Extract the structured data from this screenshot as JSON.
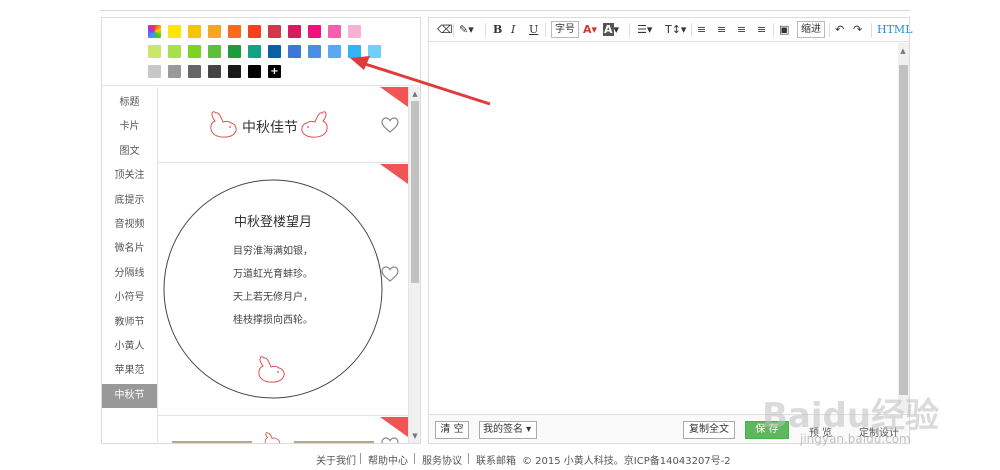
{
  "palette": {
    "row1": [
      "#rainbow",
      "#ffe600",
      "#f7c500",
      "#f5a623",
      "#f96b1b",
      "#f6401b",
      "#d0384b",
      "#d81b60",
      "#f0127c",
      "#f55fb0",
      "#f9b1d2"
    ],
    "row2": [
      "#c9e86a",
      "#a6e04a",
      "#7ed321",
      "#5fbf3d",
      "#1e9b3f",
      "#15a083",
      "#0b5fa5",
      "#3d77d8",
      "#4a90e2",
      "#5aa7f2",
      "#2fb5f5",
      "#6fd0fa"
    ],
    "row3": [
      "#c7c7c7",
      "#999999",
      "#666666",
      "#444444",
      "#1a1a1a",
      "#000000"
    ],
    "plus_label": "+"
  },
  "sidebar": {
    "items": [
      "标题",
      "卡片",
      "图文",
      "顶关注",
      "底提示",
      "音视频",
      "微名片",
      "分隔线",
      "小符号",
      "教师节",
      "小黄人",
      "苹果范",
      "中秋节"
    ],
    "active_index": 12
  },
  "templates": {
    "card1": {
      "title": "中秋佳节"
    },
    "card2": {
      "title": "中秋登楼望月",
      "lines": [
        "目穷淮海满如银，",
        "万道虹光育蚌珍。",
        "天上若无修月户，",
        "桂枝撑损向西轮。"
      ]
    }
  },
  "toolbar": {
    "bold": "B",
    "italic": "I",
    "underline": "U",
    "font_size": "字号",
    "font_color": "A",
    "bg_color": "A",
    "indent": "缩进",
    "html": "HTML"
  },
  "bottom": {
    "clear": "清 空",
    "signature": "我的签名",
    "copy_all": "复制全文",
    "save": "保 存",
    "preview": "预 览",
    "custom": "定制设计"
  },
  "footer": {
    "about": "关于我们",
    "help": "帮助中心",
    "terms": "服务协议",
    "contact": "联系邮箱",
    "copyright": "© 2015 小黄人科技。京ICP备14043207号-2"
  },
  "watermark": {
    "main": "Baidu经验",
    "sub": "jingyan.baidu.com"
  }
}
